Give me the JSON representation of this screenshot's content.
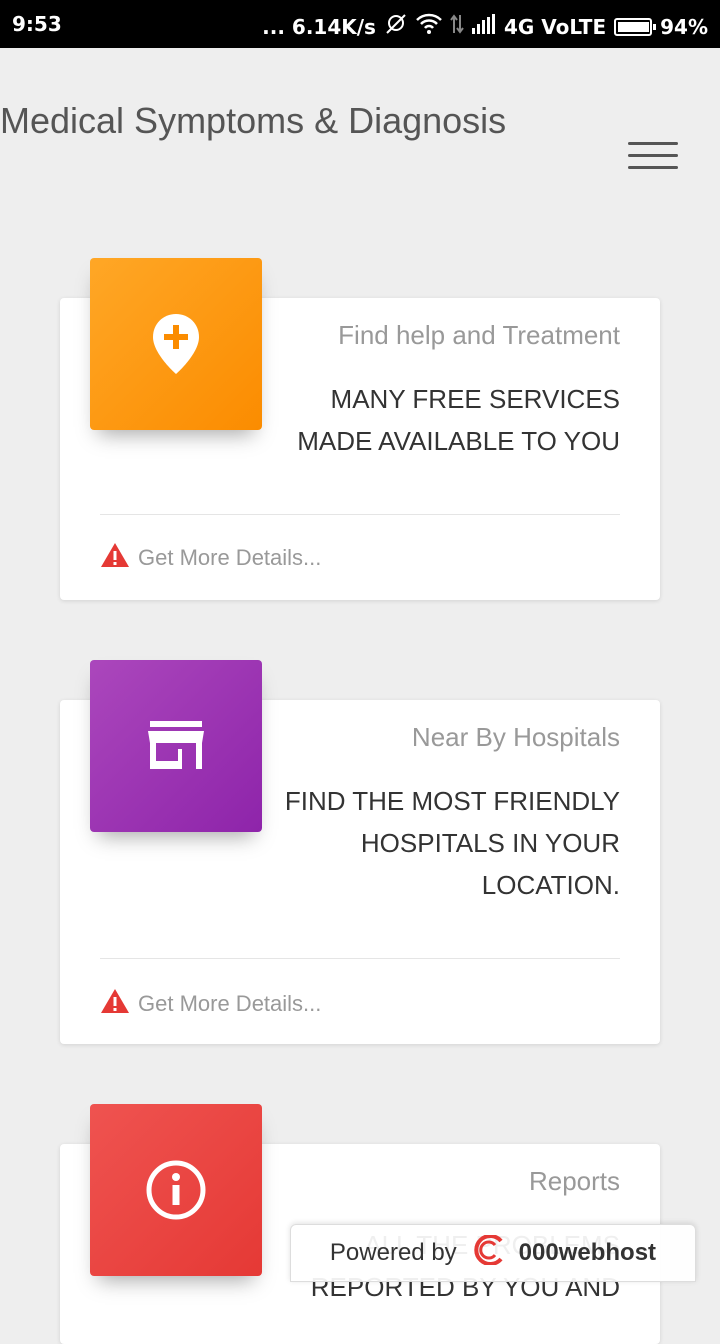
{
  "status_bar": {
    "time": "9:53",
    "network_speed": "... 6.14K/s",
    "network_type": "4G VoLTE",
    "battery": "94%"
  },
  "app": {
    "title": "Medical Symptoms & Diagnosis"
  },
  "cards": [
    {
      "category": "Find help and Treatment",
      "title": "MANY FREE SERVICES MADE AVAILABLE TO YOU",
      "footer": "Get More Details...",
      "icon": "location-plus-icon",
      "color": "#fb8c00"
    },
    {
      "category": "Near By Hospitals",
      "title": "FIND THE MOST FRIENDLY HOSPITALS IN YOUR LOCATION.",
      "footer": "Get More Details...",
      "icon": "store-icon",
      "color": "#8e24aa"
    },
    {
      "category": "Reports",
      "title": "ALL THE PROBLEMS REPORTED BY YOU AND",
      "icon": "info-icon",
      "color": "#e53935"
    }
  ],
  "badge": {
    "powered_label": "Powered by",
    "brand": "000webhost"
  }
}
